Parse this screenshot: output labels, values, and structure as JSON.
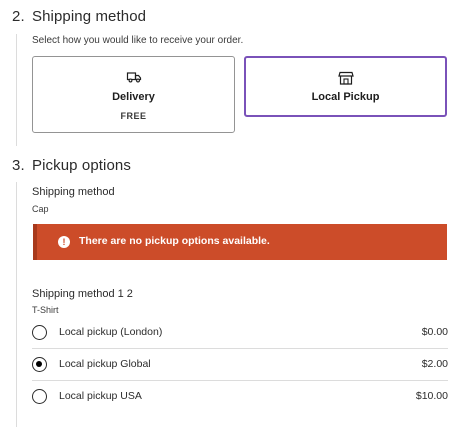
{
  "shipping_step": {
    "number": "2.",
    "title": "Shipping method",
    "description": "Select how you would like to receive your order.",
    "options": [
      {
        "label": "Delivery",
        "price": "FREE",
        "icon": "truck-icon"
      },
      {
        "label": "Local Pickup",
        "price": "",
        "icon": "store-icon"
      }
    ],
    "selected": "Local Pickup"
  },
  "pickup_step": {
    "number": "3.",
    "title": "Pickup options",
    "packages": [
      {
        "title": "Shipping method",
        "item": "Cap"
      },
      {
        "title": "Shipping method 1 2",
        "item": "T-Shirt"
      }
    ],
    "notice": {
      "text": "There are no pickup options available.",
      "color": "#cc4c29"
    },
    "rates": [
      {
        "label": "Local pickup (London)",
        "price": "$0.00",
        "checked": false
      },
      {
        "label": "Local pickup Global",
        "price": "$2.00",
        "checked": true
      },
      {
        "label": "Local pickup USA",
        "price": "$10.00",
        "checked": false
      }
    ]
  },
  "colors": {
    "accent": "#7a52b9",
    "error": "#cc4c29"
  }
}
